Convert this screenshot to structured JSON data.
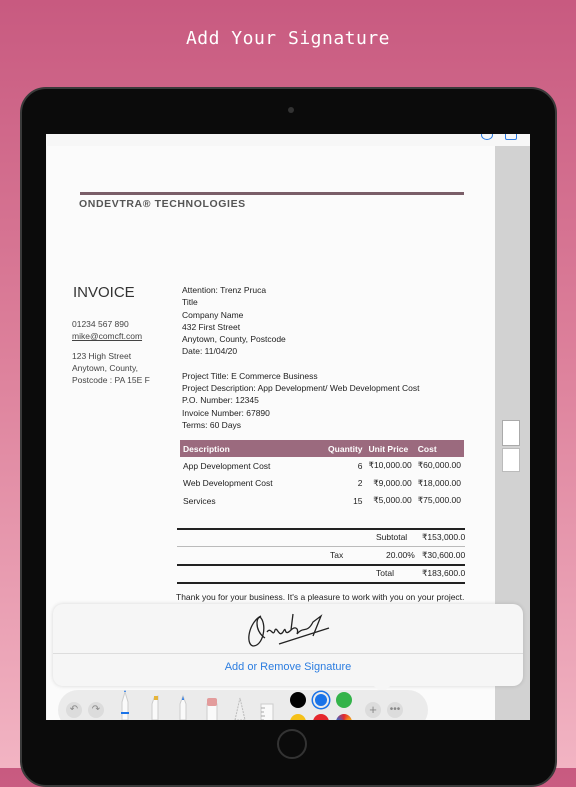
{
  "headline": "Add Your Signature",
  "document": {
    "company": "ONDEVTRA® TECHNOLOGIES",
    "title": "INVOICE",
    "phone": "01234 567 890",
    "email": "mike@comcft.com",
    "address": [
      "123 High Street",
      "Anytown, County,",
      "Postcode : PA 15E F"
    ],
    "recipient": [
      "Attention: Trenz Pruca",
      "Title",
      "Company Name",
      "432 First Street",
      "Anytown, County, Postcode",
      "Date: 11/04/20"
    ],
    "project": [
      "Project Title: E Commerce Business",
      "Project Description: App Development/ Web Development Cost",
      "P.O. Number: 12345",
      "Invoice Number: 67890",
      "Terms: 60 Days"
    ],
    "table": {
      "headers": [
        "Description",
        "Quantity",
        "Unit Price",
        "Cost"
      ],
      "rows": [
        [
          "App Development Cost",
          "6",
          "₹10,000.00",
          "₹60,000.00"
        ],
        [
          "Web Development Cost",
          "2",
          "₹9,000.00",
          "₹18,000.00"
        ],
        [
          "Services",
          "15",
          "₹5,000.00",
          "₹75,000.00"
        ]
      ]
    },
    "subtotal_label": "Subtotal",
    "subtotal": "₹153,000.0",
    "tax_label": "Tax",
    "tax_rate": "20.00%",
    "tax": "₹30,600.00",
    "total_label": "Total",
    "total": "₹183,600.0",
    "thanks": "Thank you for your business. It's a pleasure to work with you on your project."
  },
  "signature_popup": {
    "button": "Add or Remove Signature"
  },
  "toolbar": {
    "tools": [
      "undo",
      "redo",
      "pen",
      "marker",
      "pencil",
      "eraser",
      "lasso",
      "ruler"
    ],
    "colors": [
      "#000000",
      "#1a73e8",
      "#34b34a",
      "#f5c018",
      "#e5262c",
      "multicolor"
    ],
    "selected_color": "#1a73e8"
  }
}
